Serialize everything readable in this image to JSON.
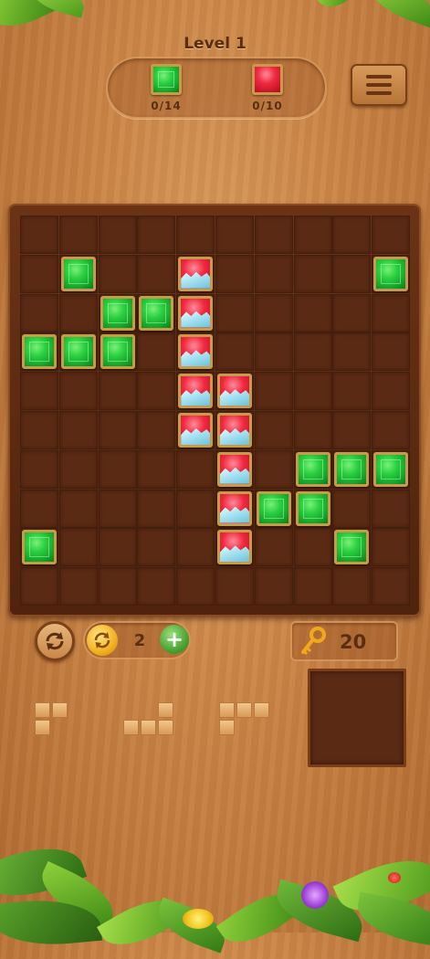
{
  "header": {
    "level_title": "Level 1"
  },
  "goals": [
    {
      "gem": "green-gem",
      "color": "#1fc23a",
      "count": "0/14"
    },
    {
      "gem": "red-gem",
      "color": "#e41f33",
      "count": "0/10"
    }
  ],
  "board": {
    "rows": 10,
    "cols": 10,
    "green_gems": [
      [
        1,
        1
      ],
      [
        1,
        9
      ],
      [
        2,
        2
      ],
      [
        2,
        3
      ],
      [
        3,
        0
      ],
      [
        3,
        1
      ],
      [
        3,
        2
      ],
      [
        6,
        7
      ],
      [
        6,
        8
      ],
      [
        6,
        9
      ],
      [
        7,
        6
      ],
      [
        7,
        7
      ],
      [
        8,
        0
      ],
      [
        8,
        8
      ]
    ],
    "red_ice_gems": [
      [
        1,
        4
      ],
      [
        2,
        4
      ],
      [
        3,
        4
      ],
      [
        4,
        4
      ],
      [
        4,
        5
      ],
      [
        5,
        4
      ],
      [
        5,
        5
      ],
      [
        6,
        5
      ],
      [
        7,
        5
      ],
      [
        8,
        5
      ]
    ]
  },
  "controls": {
    "refresh_icon": "refresh-icon",
    "rotate_count": "2",
    "add_symbol": "+",
    "key_count": "20"
  },
  "pieces": [
    {
      "name": "piece-l-corner",
      "blocks": [
        [
          0,
          0
        ],
        [
          0,
          1
        ],
        [
          1,
          0
        ]
      ]
    },
    {
      "name": "piece-j-shape",
      "blocks": [
        [
          0,
          2
        ],
        [
          1,
          0
        ],
        [
          1,
          1
        ],
        [
          1,
          2
        ]
      ]
    },
    {
      "name": "piece-l-shape",
      "blocks": [
        [
          0,
          0
        ],
        [
          0,
          1
        ],
        [
          0,
          2
        ],
        [
          1,
          0
        ]
      ]
    }
  ],
  "colors": {
    "wood": "#c98446",
    "board": "#5a2a14",
    "green_gem": "#1fc23a",
    "red_gem": "#e41f33",
    "ice": "#a8e2f2",
    "piece": "#e6b070"
  }
}
